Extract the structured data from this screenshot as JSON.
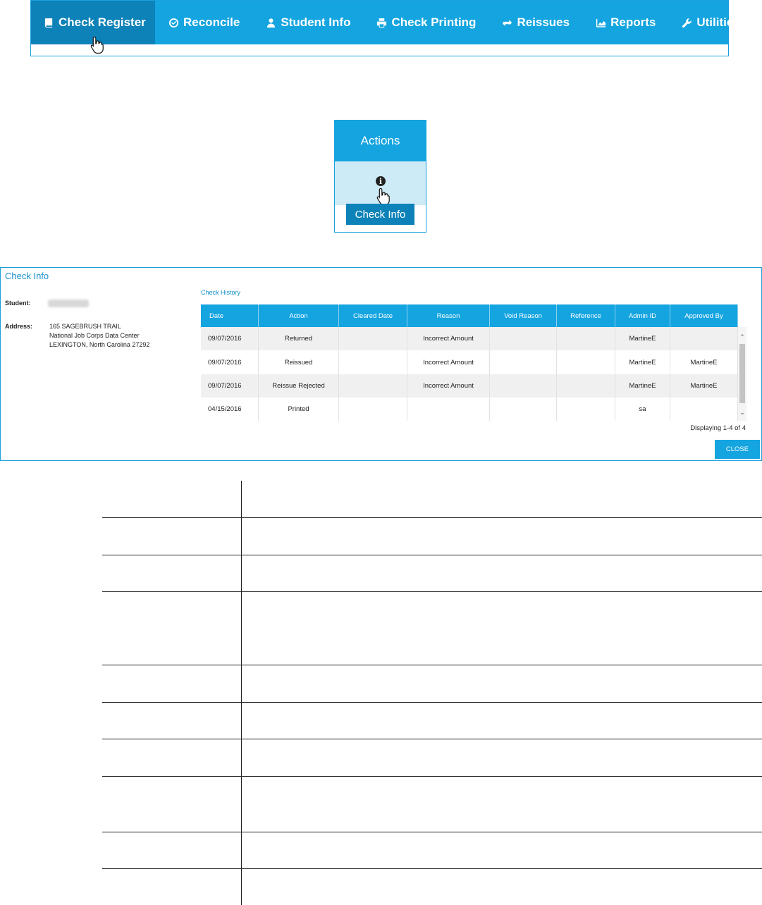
{
  "nav": {
    "items": [
      {
        "label": "Check Register",
        "icon": "book-icon",
        "active": true
      },
      {
        "label": "Reconcile",
        "icon": "check-circle-icon",
        "active": false
      },
      {
        "label": "Student Info",
        "icon": "user-icon",
        "active": false
      },
      {
        "label": "Check Printing",
        "icon": "printer-icon",
        "active": false
      },
      {
        "label": "Reissues",
        "icon": "refresh-icon",
        "active": false
      },
      {
        "label": "Reports",
        "icon": "area-chart-icon",
        "active": false
      },
      {
        "label": "Utilities",
        "icon": "wrench-icon",
        "active": false
      }
    ]
  },
  "actions": {
    "header": "Actions",
    "info_icon": "i",
    "button_label": "Check Info"
  },
  "dialog": {
    "title": "Check Info",
    "student_label": "Student:",
    "address_label": "Address:",
    "address_lines": [
      "165 SAGEBRUSH TRAIL",
      "National Job Corps Data Center",
      "LEXINGTON, North Carolina 27292"
    ],
    "history_title": "Check History",
    "columns": [
      "Date",
      "Action",
      "Cleared Date",
      "Reason",
      "Void Reason",
      "Reference",
      "Admin ID",
      "Approved By"
    ],
    "rows": [
      [
        "09/07/2016",
        "Returned",
        "",
        "Incorrect Amount",
        "",
        "",
        "MartineE",
        ""
      ],
      [
        "09/07/2016",
        "Reissued",
        "",
        "Incorrect Amount",
        "",
        "",
        "MartineE",
        "MartineE"
      ],
      [
        "09/07/2016",
        "Reissue Rejected",
        "",
        "Incorrect Amount",
        "",
        "",
        "MartineE",
        "MartineE"
      ],
      [
        "04/15/2016",
        "Printed",
        "",
        "",
        "",
        "",
        "sa",
        ""
      ]
    ],
    "displaying": "Displaying 1-4 of 4",
    "close_label": "CLOSE"
  },
  "colors": {
    "primary": "#14a4e0",
    "active": "#0d82b8",
    "light": "#cdeaf7"
  }
}
